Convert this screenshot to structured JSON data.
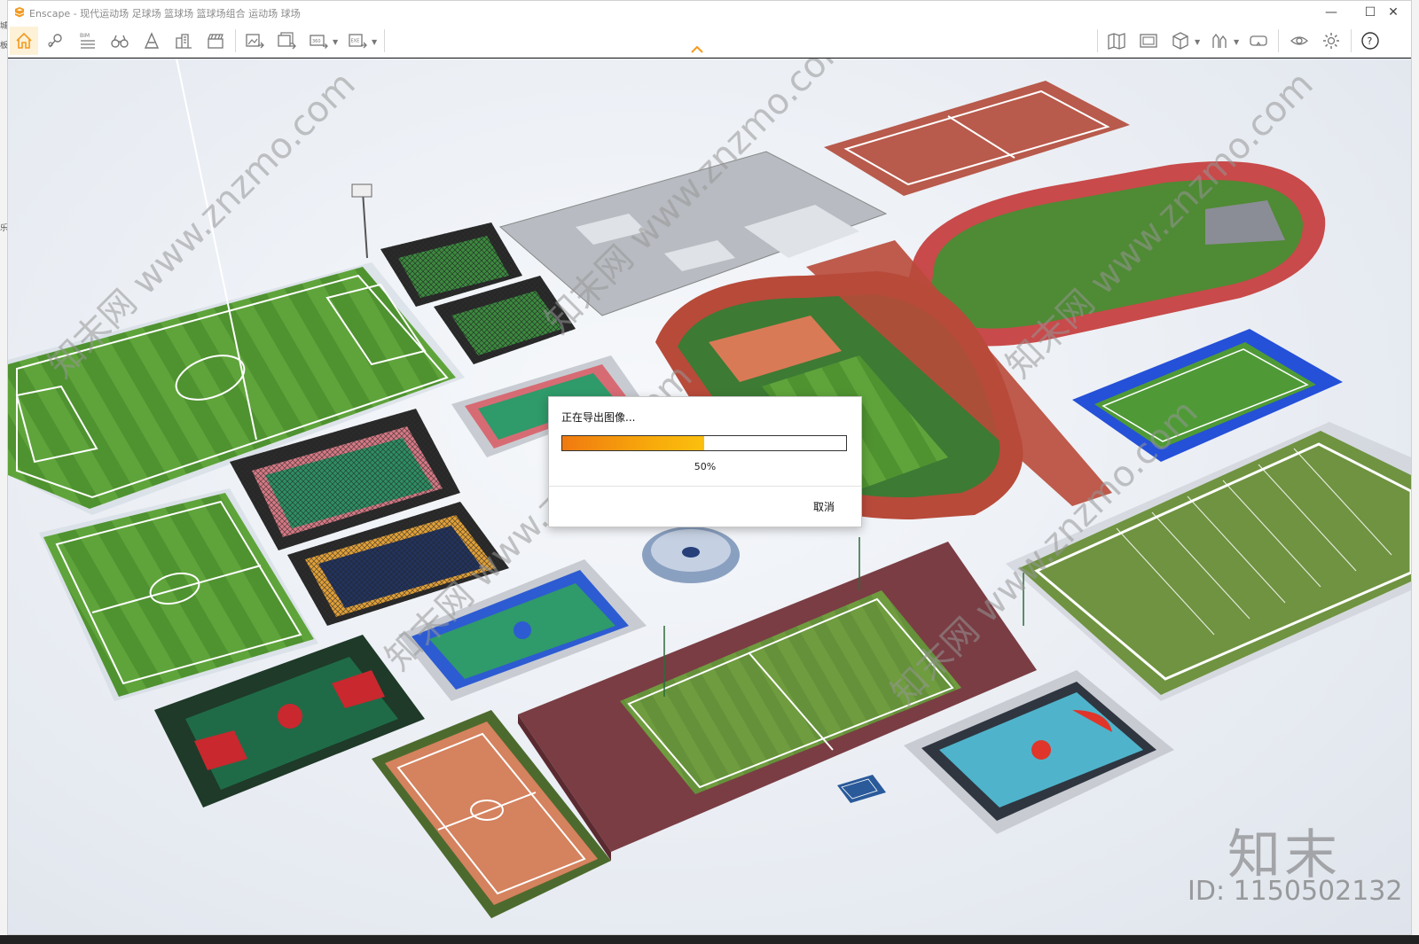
{
  "window": {
    "title": "Enscape - 现代运动场 足球场 篮球场 篮球场组合 运动场 球场",
    "controls": {
      "minimize": "—",
      "maximize": "☐",
      "close": "✕"
    }
  },
  "background_app": {
    "left_text": [
      "城",
      "板",
      "乐"
    ]
  },
  "toolbar": {
    "left_tools": [
      {
        "name": "home",
        "active": true
      },
      {
        "name": "map-pin"
      },
      {
        "name": "bim",
        "label": "BIM"
      },
      {
        "name": "binoculars"
      },
      {
        "name": "navigation-a"
      },
      {
        "name": "buildings"
      },
      {
        "name": "clapper"
      },
      {
        "name": "export-image"
      },
      {
        "name": "batch-export"
      },
      {
        "name": "export-panorama"
      },
      {
        "name": "export-exe"
      }
    ],
    "right_tools": [
      {
        "name": "map-view"
      },
      {
        "name": "screenshot"
      },
      {
        "name": "cube"
      },
      {
        "name": "asset-library"
      },
      {
        "name": "vr-headset"
      },
      {
        "name": "eye"
      },
      {
        "name": "settings"
      },
      {
        "name": "help",
        "label": "?"
      }
    ]
  },
  "watermarks": {
    "site": "知末网 www.znzmo.com",
    "logo": "知末",
    "id": "ID: 1150502132"
  },
  "dialog": {
    "title": "正在导出图像...",
    "progress_percent": 50,
    "progress_text": "50%",
    "cancel_label": "取消"
  },
  "colors": {
    "accent": "#f5a623",
    "progress_start": "#f07a10",
    "progress_end": "#fbbf0e",
    "grass": "#5e9a3c",
    "track": "#b8453a",
    "court_blue": "#2a5bd6"
  }
}
